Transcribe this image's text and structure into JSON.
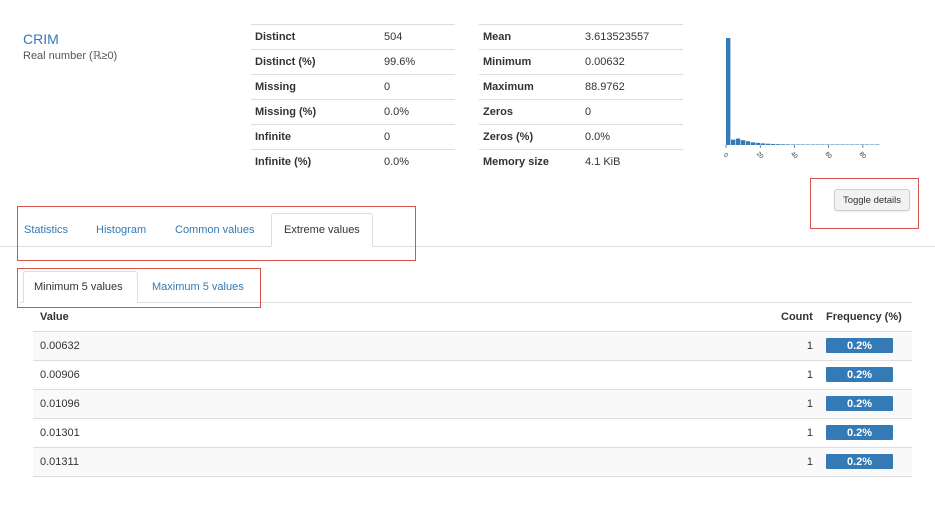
{
  "variable": {
    "name": "CRIM",
    "type": "Real number (ℝ≥0)"
  },
  "stats_left": [
    {
      "label": "Distinct",
      "value": "504"
    },
    {
      "label": "Distinct (%)",
      "value": "99.6%"
    },
    {
      "label": "Missing",
      "value": "0"
    },
    {
      "label": "Missing (%)",
      "value": "0.0%"
    },
    {
      "label": "Infinite",
      "value": "0"
    },
    {
      "label": "Infinite (%)",
      "value": "0.0%"
    }
  ],
  "stats_right": [
    {
      "label": "Mean",
      "value": "3.613523557"
    },
    {
      "label": "Minimum",
      "value": "0.00632"
    },
    {
      "label": "Maximum",
      "value": "88.9762"
    },
    {
      "label": "Zeros",
      "value": "0"
    },
    {
      "label": "Zeros (%)",
      "value": "0.0%"
    },
    {
      "label": "Memory size",
      "value": "4.1 KiB"
    }
  ],
  "chart_data": {
    "type": "bar",
    "x_ticks": [
      "0",
      "20",
      "40",
      "60",
      "80"
    ],
    "xlim": [
      0,
      90
    ],
    "bin_heights_relative": [
      1.0,
      0.05,
      0.06,
      0.045,
      0.035,
      0.025,
      0.02,
      0.015,
      0.012,
      0.01,
      0.008,
      0.007,
      0.006,
      0.005,
      0.004,
      0.004,
      0.003,
      0.003,
      0.002,
      0.002,
      0.002,
      0.002,
      0.001,
      0.001,
      0.001,
      0.001,
      0.001,
      0.001,
      0.001,
      0.001,
      0.001
    ],
    "color": "#337ab7"
  },
  "toggle_details_label": "Toggle details",
  "tabs": [
    {
      "label": "Statistics"
    },
    {
      "label": "Histogram"
    },
    {
      "label": "Common values"
    },
    {
      "label": "Extreme values"
    }
  ],
  "subtabs": [
    {
      "label": "Minimum 5 values"
    },
    {
      "label": "Maximum 5 values"
    }
  ],
  "table": {
    "headers": {
      "value": "Value",
      "count": "Count",
      "frequency": "Frequency (%)"
    },
    "rows": [
      {
        "value": "0.00632",
        "count": "1",
        "frequency": "0.2%"
      },
      {
        "value": "0.00906",
        "count": "1",
        "frequency": "0.2%"
      },
      {
        "value": "0.01096",
        "count": "1",
        "frequency": "0.2%"
      },
      {
        "value": "0.01301",
        "count": "1",
        "frequency": "0.2%"
      },
      {
        "value": "0.01311",
        "count": "1",
        "frequency": "0.2%"
      }
    ]
  },
  "colors": {
    "accent": "#337ab7",
    "highlight": "#d9534f"
  }
}
